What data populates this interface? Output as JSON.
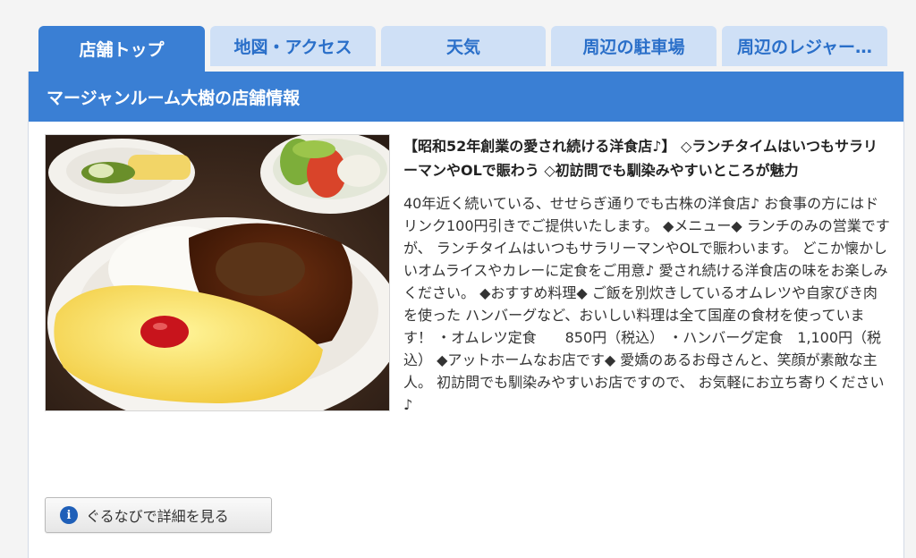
{
  "tabs": [
    {
      "label": "店舗トップ",
      "active": true
    },
    {
      "label": "地図・アクセス",
      "active": false
    },
    {
      "label": "天気",
      "active": false
    },
    {
      "label": "周辺の駐車場",
      "active": false
    },
    {
      "label": "周辺のレジャー…",
      "active": false
    }
  ],
  "header": {
    "title": "マージャンルーム大樹の店舗情報"
  },
  "main": {
    "headline": "【昭和52年創業の愛され続ける洋食店♪】 ◇ランチタイムはいつもサラリーマンやOLで賑わう ◇初訪問でも馴染みやすいところが魅力",
    "description": "40年近く続いている、せせらぎ通りでも古株の洋食店♪ お食事の方にはドリンク100円引きでご提供いたします。 ◆メニュー◆ ランチのみの営業ですが、 ランチタイムはいつもサラリーマンやOLで賑わいます。 どこか懐かしいオムライスやカレーに定食をご用意♪ 愛され続ける洋食店の味をお楽しみください。 ◆おすすめ料理◆ ご飯を別炊きしているオムレツや自家びき肉を使った ハンバーグなど、おいしい料理は全て国産の食材を使っています！ ・オムレツ定食　　850円（税込） ・ハンバーグ定食　1,100円（税込） ◆アットホームなお店です◆ 愛嬌のあるお母さんと、笑顔が素敵な主人。 初訪問でも馴染みやすいお店ですので、 お気軽にお立ち寄りください♪"
  },
  "detail_button": {
    "label": "ぐるなびで詳細を見る",
    "icon": "info-icon"
  },
  "colors": {
    "accent": "#3a7fd4",
    "tab_inactive": "#cfe0f6",
    "tab_inactive_text": "#2a6fc9"
  }
}
